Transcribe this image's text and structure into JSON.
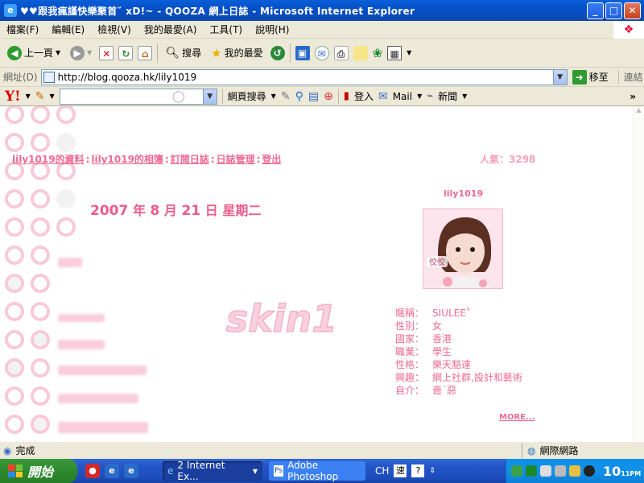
{
  "window": {
    "title": "♥♥跟我瘋謹快樂聚首ˇ xD!~ - QOOZA 網上日誌 - Microsoft Internet Explorer",
    "min_label": "_",
    "max_label": "□",
    "close_label": "✕"
  },
  "menu": [
    "檔案(F)",
    "編輯(E)",
    "檢視(V)",
    "我的最愛(A)",
    "工具(T)",
    "說明(H)"
  ],
  "toolbar": {
    "back": "上一頁",
    "search": "搜尋",
    "favorites": "我的最愛"
  },
  "address": {
    "label": "網址(D)",
    "url": "http://blog.qooza.hk/lily1019",
    "go": "移至",
    "links": "連結"
  },
  "yahoo": {
    "logo": "Y!",
    "web_search": "網頁搜尋",
    "login": "登入",
    "mail": "Mail",
    "news": "新聞",
    "more": "»"
  },
  "blog": {
    "nav": [
      "lily1019的資料",
      "lily1019的相簿",
      "訂閱日誌",
      "日誌管理",
      "登出"
    ],
    "nav_sep": ":",
    "popularity": "人氣：3298",
    "date": {
      "year": "2007",
      "year_unit": "年",
      "month": "8",
      "month_unit": "月",
      "day": "21",
      "day_unit": "日",
      "weekday": "星期二"
    },
    "username": "lily1019",
    "avatar_caption": "佼佼",
    "skin_text": "skin1",
    "profile": [
      {
        "key": "暱稱：",
        "value": "SIULEE˚"
      },
      {
        "key": "性別：",
        "value": "女"
      },
      {
        "key": "國家：",
        "value": "香港"
      },
      {
        "key": "職業：",
        "value": "學生"
      },
      {
        "key": "性格：",
        "value": "樂天豁達"
      },
      {
        "key": "興趣：",
        "value": "網上社群,設計和藝術"
      },
      {
        "key": "自介：",
        "value": "嗇˙惡"
      }
    ],
    "more": "MORE..."
  },
  "status": {
    "text": "完成",
    "zone": "網際網路"
  },
  "taskbar": {
    "start": "開始",
    "tasks": [
      "2 Internet Ex...",
      "Adobe Photoshop"
    ],
    "lang": "CH",
    "clock": "10",
    "clock_min": "11",
    "clock_ampm": "PM"
  },
  "colors": {
    "blog_pink": "#f06a92",
    "title_blue": "#0550c8",
    "start_green": "#2d8a2d"
  }
}
